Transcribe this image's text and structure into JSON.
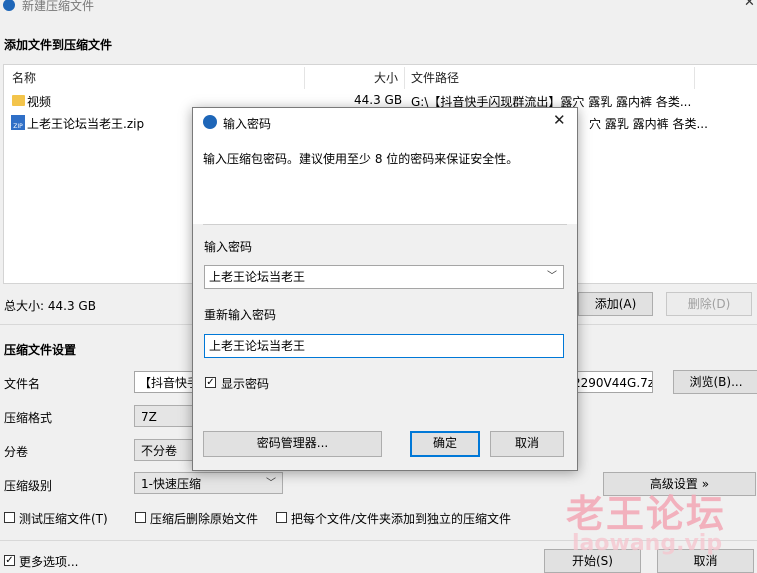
{
  "window": {
    "title": "新建压缩文件"
  },
  "add_section": {
    "title": "添加文件到压缩文件"
  },
  "file_list": {
    "columns": [
      "名称",
      "大小",
      "文件路径"
    ],
    "rows": [
      {
        "name": "视频",
        "size": "44.3 GB",
        "path": "G:\\【抖音快手闪现群流出】露穴 露乳 露内裤 各类...",
        "icon": "folder-icon"
      },
      {
        "name": "上老王论坛当老王.zip",
        "size": "",
        "path": "穴 露乳 露内裤 各类...",
        "icon": "zip-icon"
      }
    ]
  },
  "total_size": "总大小: 44.3 GB",
  "buttons": {
    "add": "添加(A)",
    "delete": "删除(D)",
    "browse": "浏览(B)...",
    "advanced": "高级设置 »",
    "start": "开始(S)",
    "cancel": "取消"
  },
  "settings": {
    "title": "压缩文件设置",
    "filename_label": "文件名",
    "filename_value": "【抖音快手",
    "filename_suffix": "2290V44G.7z",
    "format_label": "压缩格式",
    "format_value": "7Z",
    "split_label": "分卷",
    "split_value": "不分卷",
    "level_label": "压缩级别",
    "level_value": "1-快速压缩",
    "test_label": "测试压缩文件(T)",
    "delete_after_label": "压缩后删除原始文件",
    "separate_label": "把每个文件/文件夹添加到独立的压缩文件",
    "more_options_label": "更多选项..."
  },
  "dialog": {
    "title": "输入密码",
    "info": "输入压缩包密码。建议使用至少 8 位的密码来保证安全性。",
    "password_label": "输入密码",
    "password_value": "上老王论坛当老王",
    "confirm_label": "重新输入密码",
    "confirm_value": "上老王论坛当老王",
    "show_password_label": "显示密码",
    "manager_button": "密码管理器...",
    "ok_button": "确定",
    "cancel_button": "取消"
  },
  "watermark": {
    "text": "老王论坛",
    "sub": "laowang.vip"
  },
  "colors": {
    "accent": "#0078d7",
    "brand": "#1e66b8"
  }
}
